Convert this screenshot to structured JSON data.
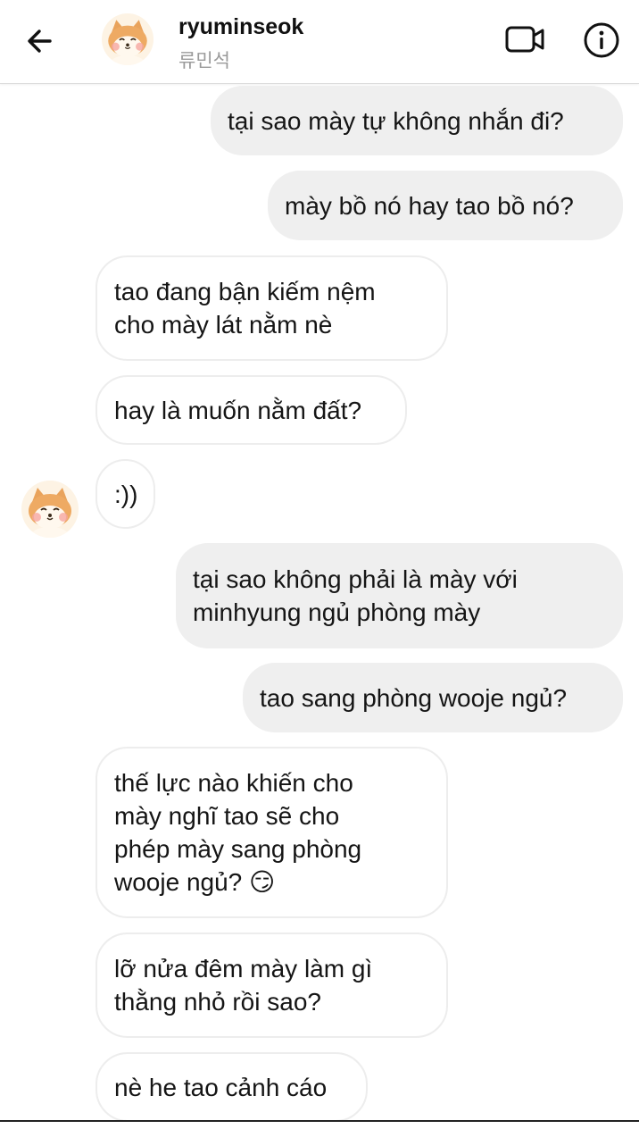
{
  "header": {
    "username": "ryuminseok",
    "subtitle": "류민석",
    "back_icon": "arrow-left-icon",
    "video_icon": "video-camera-icon",
    "info_icon": "info-icon"
  },
  "messages": [
    {
      "side": "sent",
      "text": "tại sao mày tự không nhắn đi?"
    },
    {
      "side": "sent",
      "text": "mày bồ nó hay tao bồ nó?"
    },
    {
      "side": "received",
      "text": "tao đang bận kiếm nệm\ncho mày lát nằm nè"
    },
    {
      "side": "received",
      "text": "hay là muốn nằm đất?"
    },
    {
      "side": "received",
      "text": ":))"
    },
    {
      "side": "sent",
      "text": "tại sao không phải là mày với\nminhyung ngủ phòng mày"
    },
    {
      "side": "sent",
      "text": "tao sang phòng wooje ngủ?"
    },
    {
      "side": "received",
      "text": "thế lực nào khiến cho\nmày nghĩ tao sẽ cho\nphép mày sang phòng\nwooje ngủ? 😏"
    },
    {
      "side": "received",
      "text": "lỡ nửa đêm mày làm gì\nthằng nhỏ rồi sao?"
    },
    {
      "side": "received",
      "text": "nè he tao cảnh cáo"
    }
  ],
  "colors": {
    "sent_bubble": "#efefef",
    "received_border": "#ededed",
    "text": "#151515",
    "subtitle": "#9a9a9a"
  }
}
